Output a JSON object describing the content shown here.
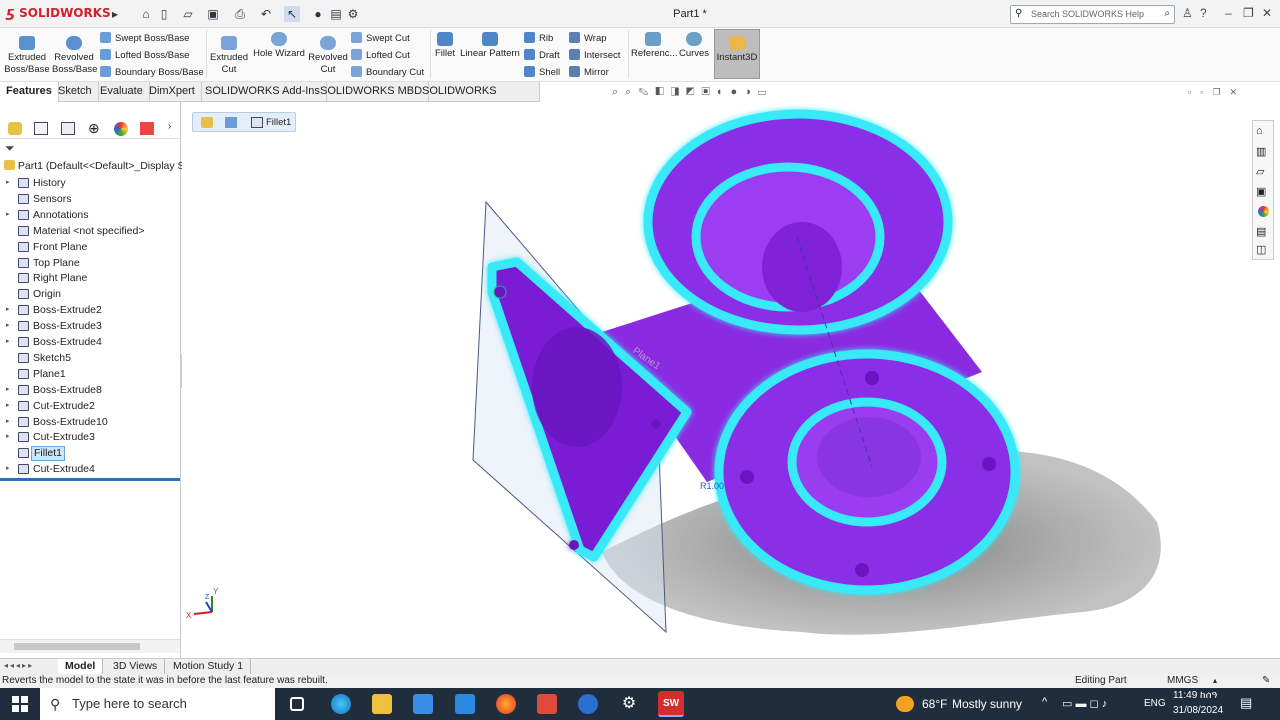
{
  "app": {
    "brand": "SOLIDWORKS",
    "title": "Part1 *",
    "search_placeholder": "Search SOLIDWORKS Help"
  },
  "ribbon": {
    "extruded_boss": "Extruded Boss/Base",
    "revolved_boss": "Revolved Boss/Base",
    "swept_boss": "Swept Boss/Base",
    "lofted_boss": "Lofted Boss/Base",
    "boundary_boss": "Boundary Boss/Base",
    "extruded_cut": "Extruded Cut",
    "hole_wizard": "Hole Wizard",
    "revolved_cut": "Revolved Cut",
    "swept_cut": "Swept Cut",
    "lofted_cut": "Lofted Cut",
    "boundary_cut": "Boundary Cut",
    "fillet": "Fillet",
    "linear_pattern": "Linear Pattern",
    "rib": "Rib",
    "draft": "Draft",
    "shell": "Shell",
    "wrap": "Wrap",
    "intersect": "Intersect",
    "mirror": "Mirror",
    "reference": "Referenc...",
    "curves": "Curves",
    "instant3d": "Instant3D"
  },
  "tabs": [
    "Features",
    "Sketch",
    "Evaluate",
    "DimXpert",
    "SOLIDWORKS Add-Ins",
    "SOLIDWORKS MBD",
    "SOLIDWORKS Inspection"
  ],
  "tree": {
    "root": "Part1  (Default<<Default>_Display S",
    "items": [
      "History",
      "Sensors",
      "Annotations",
      "Material <not specified>",
      "Front Plane",
      "Top Plane",
      "Right Plane",
      "Origin",
      "Boss-Extrude2",
      "Boss-Extrude3",
      "Boss-Extrude4",
      "Sketch5",
      "Plane1",
      "Boss-Extrude8",
      "Cut-Extrude2",
      "Boss-Extrude10",
      "Cut-Extrude3",
      "Fillet1",
      "Cut-Extrude4"
    ]
  },
  "breadcrumb": "Fillet1",
  "viewport_labels": {
    "plane": "Plane1",
    "dim": "R1.00"
  },
  "bottom_tabs": [
    "Model",
    "3D Views",
    "Motion Study 1"
  ],
  "status": {
    "message": "Reverts the model to the state it was in before the last feature was rebuilt.",
    "mode": "Editing Part",
    "units": "MMGS"
  },
  "taskbar": {
    "search": "Type here to search",
    "weather_temp": "68°F",
    "weather_desc": "Mostly sunny",
    "lang": "ENG",
    "time": "11:49 ከሰዓ",
    "date": "31/08/2024"
  },
  "colors": {
    "part": "#7a1fd6",
    "edge": "#35e8f5",
    "accent": "#d4202a"
  }
}
